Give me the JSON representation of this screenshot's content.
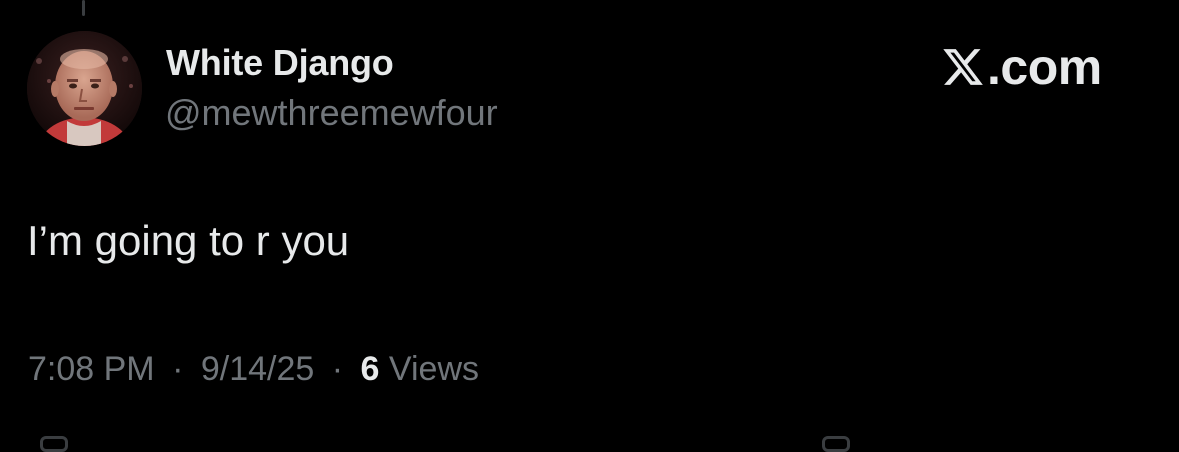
{
  "author": {
    "display_name": "White Django",
    "handle": "@mewthreemewfour",
    "avatar_icon": "user-avatar-photo"
  },
  "brand": {
    "icon": "x-logo-icon",
    "text": ".com"
  },
  "post": {
    "text": "I’m going to r you"
  },
  "meta": {
    "time": "7:08 PM",
    "date": "9/14/25",
    "separator": "·",
    "views_count": "6",
    "views_label": "Views"
  },
  "colors": {
    "background": "#000000",
    "primary_text": "#e7e9ea",
    "secondary_text": "#71767b"
  }
}
